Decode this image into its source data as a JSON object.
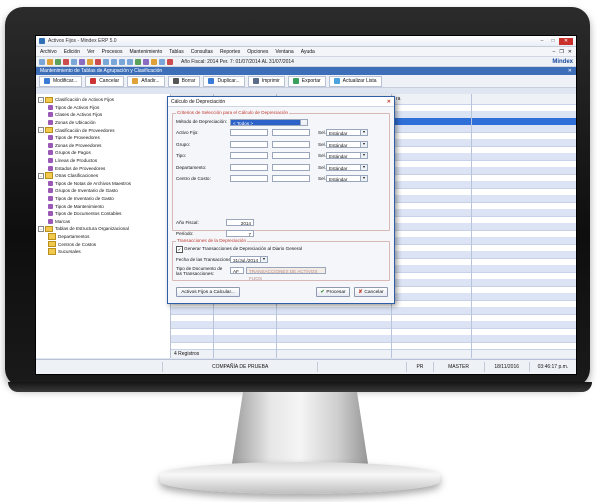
{
  "window": {
    "title": "Activos Fijos - Mindex ERP 5.0",
    "minimize": "–",
    "maximize": "□",
    "close": "✕"
  },
  "menu": {
    "items": [
      "Archivo",
      "Edición",
      "Ver",
      "Procesos",
      "Mantenimiento",
      "Tablas",
      "Consultas",
      "Reportes",
      "Opciones",
      "Ventana",
      "Ayuda"
    ],
    "minimize": "–",
    "restore": "❐",
    "close": "✕"
  },
  "toolbar": {
    "period_info": "Año Fiscal: 2014   Per. 7: 01/07/2014 AL 31/07/2014",
    "brand": "Mindex"
  },
  "child": {
    "title": "Mantenimiento de Tablas de Agrupación y Clasificación",
    "close": "✕"
  },
  "actions": [
    {
      "label": "Modificar...",
      "color": "#3a7bd5"
    },
    {
      "label": "Cancelar",
      "color": "#cc3333"
    },
    {
      "label": "Añadir...",
      "color": "#e0a13a"
    },
    {
      "label": "Borrar",
      "color": "#555555"
    },
    {
      "label": "Duplicar...",
      "color": "#3a7bd5"
    },
    {
      "label": "Imprimir",
      "color": "#5a6c87"
    },
    {
      "label": "Exportar",
      "color": "#3aa05b"
    },
    {
      "label": "Actualizar Lista",
      "color": "#4aa3df"
    }
  ],
  "tree": [
    {
      "label": "Clasificación de Activos Fijos",
      "level": 0,
      "kind": "group",
      "toggle": "−"
    },
    {
      "label": "Tipos de Activos Fijos",
      "level": 1,
      "kind": "leaf"
    },
    {
      "label": "Clases de Activos Fijos",
      "level": 1,
      "kind": "leaf"
    },
    {
      "label": "Zonas de Ubicación",
      "level": 1,
      "kind": "leaf"
    },
    {
      "label": "Clasificación de Proveedores",
      "level": 0,
      "kind": "group",
      "toggle": "−"
    },
    {
      "label": "Tipos de Proveedores",
      "level": 1,
      "kind": "leaf"
    },
    {
      "label": "Zonas de Proveedores",
      "level": 1,
      "kind": "leaf"
    },
    {
      "label": "Grupos de Pagos",
      "level": 1,
      "kind": "leaf"
    },
    {
      "label": "Líneas de Productos",
      "level": 1,
      "kind": "leaf"
    },
    {
      "label": "Estados de Proveedores",
      "level": 1,
      "kind": "leaf"
    },
    {
      "label": "Otras Clasificaciones",
      "level": 0,
      "kind": "group",
      "toggle": "−"
    },
    {
      "label": "Tipos de Notas de Archivos Maestros",
      "level": 1,
      "kind": "leaf"
    },
    {
      "label": "Grupos de Inventario de Gasto",
      "level": 1,
      "kind": "leaf"
    },
    {
      "label": "Tipos de Inventario de Gasto",
      "level": 1,
      "kind": "leaf"
    },
    {
      "label": "Tipos de Mantenimiento",
      "level": 1,
      "kind": "leaf"
    },
    {
      "label": "Tipos de Documentos Contables",
      "level": 1,
      "kind": "leaf"
    },
    {
      "label": "Marcas",
      "level": 1,
      "kind": "leaf"
    },
    {
      "label": "Tablas de Estructura Organizacional",
      "level": 0,
      "kind": "group",
      "toggle": "−"
    },
    {
      "label": "Departamentos",
      "level": 1,
      "kind": "folder"
    },
    {
      "label": "Centros de Costos",
      "level": 1,
      "kind": "folder"
    },
    {
      "label": "Sucursales",
      "level": 1,
      "kind": "folder"
    }
  ],
  "grid": {
    "header_fragment": "ra",
    "record_count": "4 Registros"
  },
  "dialog": {
    "title": "Cálculo de Depreciación",
    "close": "✕",
    "criteria_title": "Criterios de Selección para el Cálculo de Depreciación",
    "method_label": "Método de Depreciación:",
    "method_value": "< Todos >",
    "rows": [
      {
        "label": "Activo Fijo:",
        "sel_label": "Sel.",
        "sel_value": "Estándar"
      },
      {
        "label": "Grupo:",
        "sel_label": "Sel.",
        "sel_value": "Estándar"
      },
      {
        "label": "Tipo:",
        "sel_label": "Sel.",
        "sel_value": "Estándar"
      },
      {
        "label": "Departamento:",
        "sel_label": "Sel.",
        "sel_value": "Estándar"
      },
      {
        "label": "Centro de Costo:",
        "sel_label": "Sel.",
        "sel_value": "Estándar"
      }
    ],
    "fiscal_year_label": "Año Fiscal:",
    "fiscal_year_value": "2014",
    "period_label": "Período:",
    "period_value": "7",
    "trans_title": "Transacciones de la Depreciación",
    "generate_label": "Generar Transacciones de Depreciación al Diario General",
    "generate_checked": "✓",
    "date_label": "Fecha de las Transacciones:",
    "date_value": "31/Jul./2014",
    "doctype_label": "Tipo de Documento de las Transacciones:",
    "doctype_code": "AF",
    "doctype_desc": "TRANSACCIONES DE ACTIVOS FIJOS",
    "btn_assets": "Activos Fijos a Calcular...",
    "btn_process": "Procesar",
    "btn_cancel": "Cancelar",
    "ok_glyph": "✔",
    "cancel_glyph": "✘"
  },
  "status": {
    "company": "COMPAÑÍA DE PRUEBA",
    "mode": "PR",
    "user": "MASTER",
    "date": "18/11/2016",
    "time": "03:46:17 p.m."
  }
}
